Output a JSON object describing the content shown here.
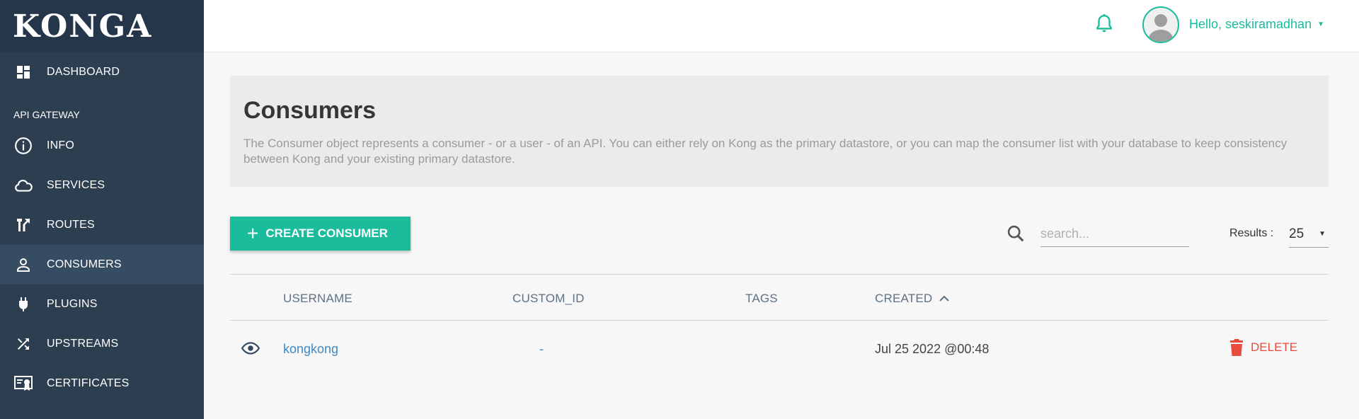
{
  "app": {
    "logo": "KONGA"
  },
  "sidebar": {
    "dashboard": {
      "label": "DASHBOARD",
      "icon": "dashboard-icon"
    },
    "section": "API GATEWAY",
    "items": [
      {
        "label": "INFO",
        "icon": "info-icon"
      },
      {
        "label": "SERVICES",
        "icon": "cloud-icon"
      },
      {
        "label": "ROUTES",
        "icon": "routes-icon"
      },
      {
        "label": "CONSUMERS",
        "icon": "person-icon",
        "active": true
      },
      {
        "label": "PLUGINS",
        "icon": "plug-icon"
      },
      {
        "label": "UPSTREAMS",
        "icon": "shuffle-icon"
      },
      {
        "label": "CERTIFICATES",
        "icon": "certificate-icon"
      }
    ]
  },
  "topbar": {
    "greeting": "Hello, seskiramadhan"
  },
  "page": {
    "title": "Consumers",
    "description": "The Consumer object represents a consumer - or a user - of an API. You can either rely on Kong as the primary datastore, or you can map the consumer list with your database to keep consistency between Kong and your existing primary datastore."
  },
  "toolbar": {
    "create_label": "CREATE CONSUMER",
    "search_placeholder": "search...",
    "results_label": "Results :",
    "results_value": "25"
  },
  "table": {
    "columns": [
      "USERNAME",
      "CUSTOM_ID",
      "TAGS",
      "CREATED"
    ],
    "rows": [
      {
        "username": "kongkong",
        "custom_id": "-",
        "tags": "",
        "created": "Jul 25 2022 @00:48",
        "delete_label": "DELETE"
      }
    ]
  },
  "colors": {
    "accent": "#1abc9c",
    "sidebar": "#2d3e50",
    "danger": "#e74c3c",
    "link": "#3d8ac7"
  }
}
